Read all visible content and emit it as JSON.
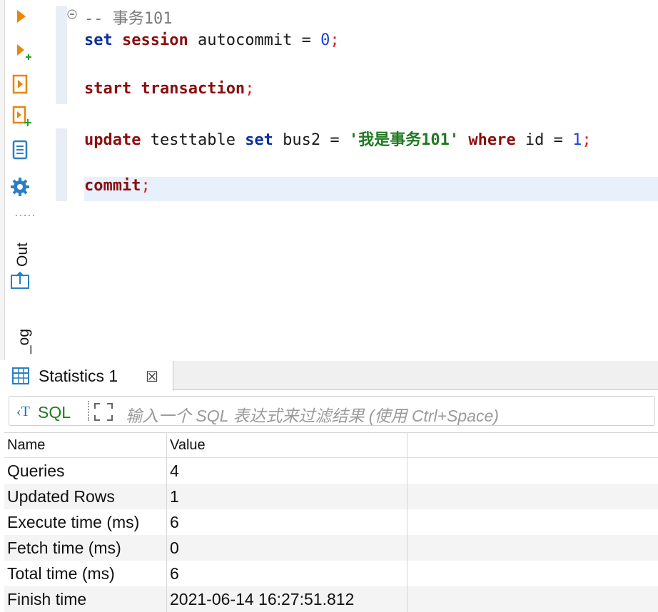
{
  "editor": {
    "lines": [
      {
        "tokens": [
          {
            "t": "-- 事务101",
            "c": "cmt"
          }
        ]
      },
      {
        "tokens": [
          {
            "t": "set",
            "c": "kw-blue"
          },
          {
            "t": " ",
            "c": ""
          },
          {
            "t": "session",
            "c": "kw-red"
          },
          {
            "t": " autocommit = ",
            "c": ""
          },
          {
            "t": "0",
            "c": "num"
          },
          {
            "t": ";",
            "c": "semi"
          }
        ]
      },
      {
        "tokens": [
          {
            "t": "start",
            "c": "kw-red"
          },
          {
            "t": " ",
            "c": ""
          },
          {
            "t": "transaction",
            "c": "kw-red"
          },
          {
            "t": ";",
            "c": "semi"
          }
        ]
      },
      {
        "tokens": [
          {
            "t": "update",
            "c": "kw-red"
          },
          {
            "t": " testtable ",
            "c": ""
          },
          {
            "t": "set",
            "c": "kw-blue"
          },
          {
            "t": " bus2 = ",
            "c": ""
          },
          {
            "t": "'我是事务101'",
            "c": "str"
          },
          {
            "t": " ",
            "c": ""
          },
          {
            "t": "where",
            "c": "kw-red"
          },
          {
            "t": " id = ",
            "c": ""
          },
          {
            "t": "1",
            "c": "num"
          },
          {
            "t": ";",
            "c": "semi"
          }
        ]
      },
      {
        "tokens": [
          {
            "t": "commit",
            "c": "kw-red"
          },
          {
            "t": ";",
            "c": "semi"
          }
        ]
      }
    ]
  },
  "side_tabs": {
    "out_label": "Out",
    "log_label": "_og"
  },
  "panel": {
    "tab_label": "Statistics 1",
    "close_glyph": "☒",
    "filter": {
      "sql_label": "SQL",
      "placeholder": "输入一个 SQL 表达式来过滤结果 (使用 Ctrl+Space)"
    }
  },
  "table": {
    "columns": [
      "Name",
      "Value"
    ],
    "rows": [
      [
        "Queries",
        "4"
      ],
      [
        "Updated Rows",
        "1"
      ],
      [
        "Execute time (ms)",
        "6"
      ],
      [
        "Fetch time (ms)",
        "0"
      ],
      [
        "Total time (ms)",
        "6"
      ],
      [
        "Finish time",
        "2021-06-14 16:27:51.812"
      ]
    ]
  },
  "colors": {
    "keyword_blue": "#0b2f9e",
    "keyword_red": "#8a0f0f",
    "string_green": "#1f7a1f",
    "number_blue": "#1a3fe0",
    "toolbar_orange": "#e8860c",
    "line_highlight": "#e8f1fb"
  },
  "icons": [
    "execute-icon",
    "execute-new-tab-icon",
    "execute-script-icon",
    "execute-script-new-tab-icon",
    "explain-plan-icon",
    "settings-icon",
    "output-icon",
    "table-grid-icon",
    "expand-icon"
  ]
}
